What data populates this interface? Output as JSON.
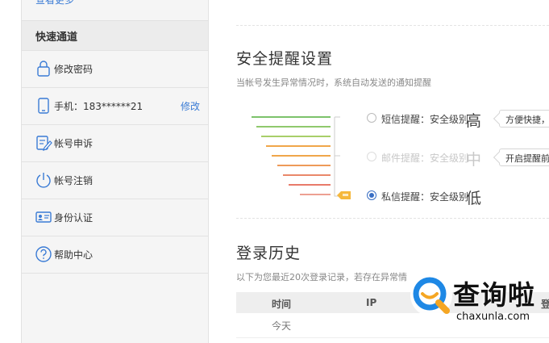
{
  "sidebar": {
    "more_link": "查看更多",
    "quick_title": "快速通道",
    "items": [
      {
        "icon": "lock-icon",
        "label": "修改密码"
      },
      {
        "icon": "phone-icon",
        "label": "手机：183******21",
        "action": "修改"
      },
      {
        "icon": "edit-document-icon",
        "label": "帐号申诉"
      },
      {
        "icon": "power-icon",
        "label": "帐号注销"
      },
      {
        "icon": "id-card-icon",
        "label": "身份认证"
      },
      {
        "icon": "help-icon",
        "label": "帮助中心"
      }
    ]
  },
  "security": {
    "title": "安全提醒设置",
    "description": "当帐号发生异常情况时，系统自动发送的通知提醒",
    "options": [
      {
        "label": "短信提醒：安全级别",
        "level": "高",
        "tip": "方便快捷，",
        "selected": false,
        "disabled": false
      },
      {
        "label": "邮件提醒：安全级别",
        "level": "中",
        "tip": "开启提醒前",
        "selected": false,
        "disabled": true
      },
      {
        "label": "私信提醒：安全级别",
        "level": "低",
        "selected": true,
        "disabled": false
      }
    ],
    "badge_icon": "message-tag-icon",
    "colors": {
      "high": "#7cc26b",
      "mid": "#f0a64a",
      "low": "#e87a6a",
      "badge": "#f5b83d"
    }
  },
  "history": {
    "title": "登录历史",
    "description": "以下为您最近20次登录记录，若存在异常情",
    "columns": [
      "时间",
      "IP",
      "登"
    ],
    "rows": [
      {
        "time": "今天"
      }
    ]
  },
  "watermark": {
    "brand": "查询啦",
    "domain": "chaxunla.com"
  }
}
